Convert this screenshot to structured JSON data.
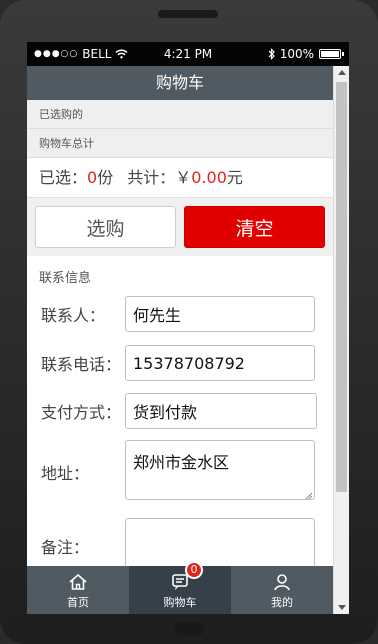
{
  "status_bar": {
    "carrier": "BELL",
    "time": "4:21 PM",
    "battery": "100%"
  },
  "header": {
    "title": "购物车"
  },
  "cart": {
    "selected_label": "已选购的",
    "total_label": "购物车总计",
    "summary": {
      "count_prefix": "已选：",
      "count_value": "0",
      "count_unit": "份",
      "total_prefix": "共计：",
      "currency": "￥",
      "total_value": "0.00",
      "total_unit": "元"
    },
    "buttons": {
      "select": "选购",
      "clear": "清空"
    }
  },
  "contact": {
    "title": "联系信息",
    "name_label": "联系人：",
    "name_value": "何先生",
    "phone_label": "联系电话：",
    "phone_value": "15378708792",
    "payment_label": "支付方式：",
    "payment_value": "货到付款",
    "address_label": "地址：",
    "address_value": "郑州市金水区",
    "note_label": "备注：",
    "note_value": ""
  },
  "tabbar": {
    "items": [
      {
        "label": "首页",
        "icon": "home-icon"
      },
      {
        "label": "购物车",
        "icon": "cart-icon",
        "badge": "0"
      },
      {
        "label": "我的",
        "icon": "user-icon"
      }
    ]
  },
  "colors": {
    "accent": "#e00000",
    "header_bg": "#4f5a62"
  }
}
